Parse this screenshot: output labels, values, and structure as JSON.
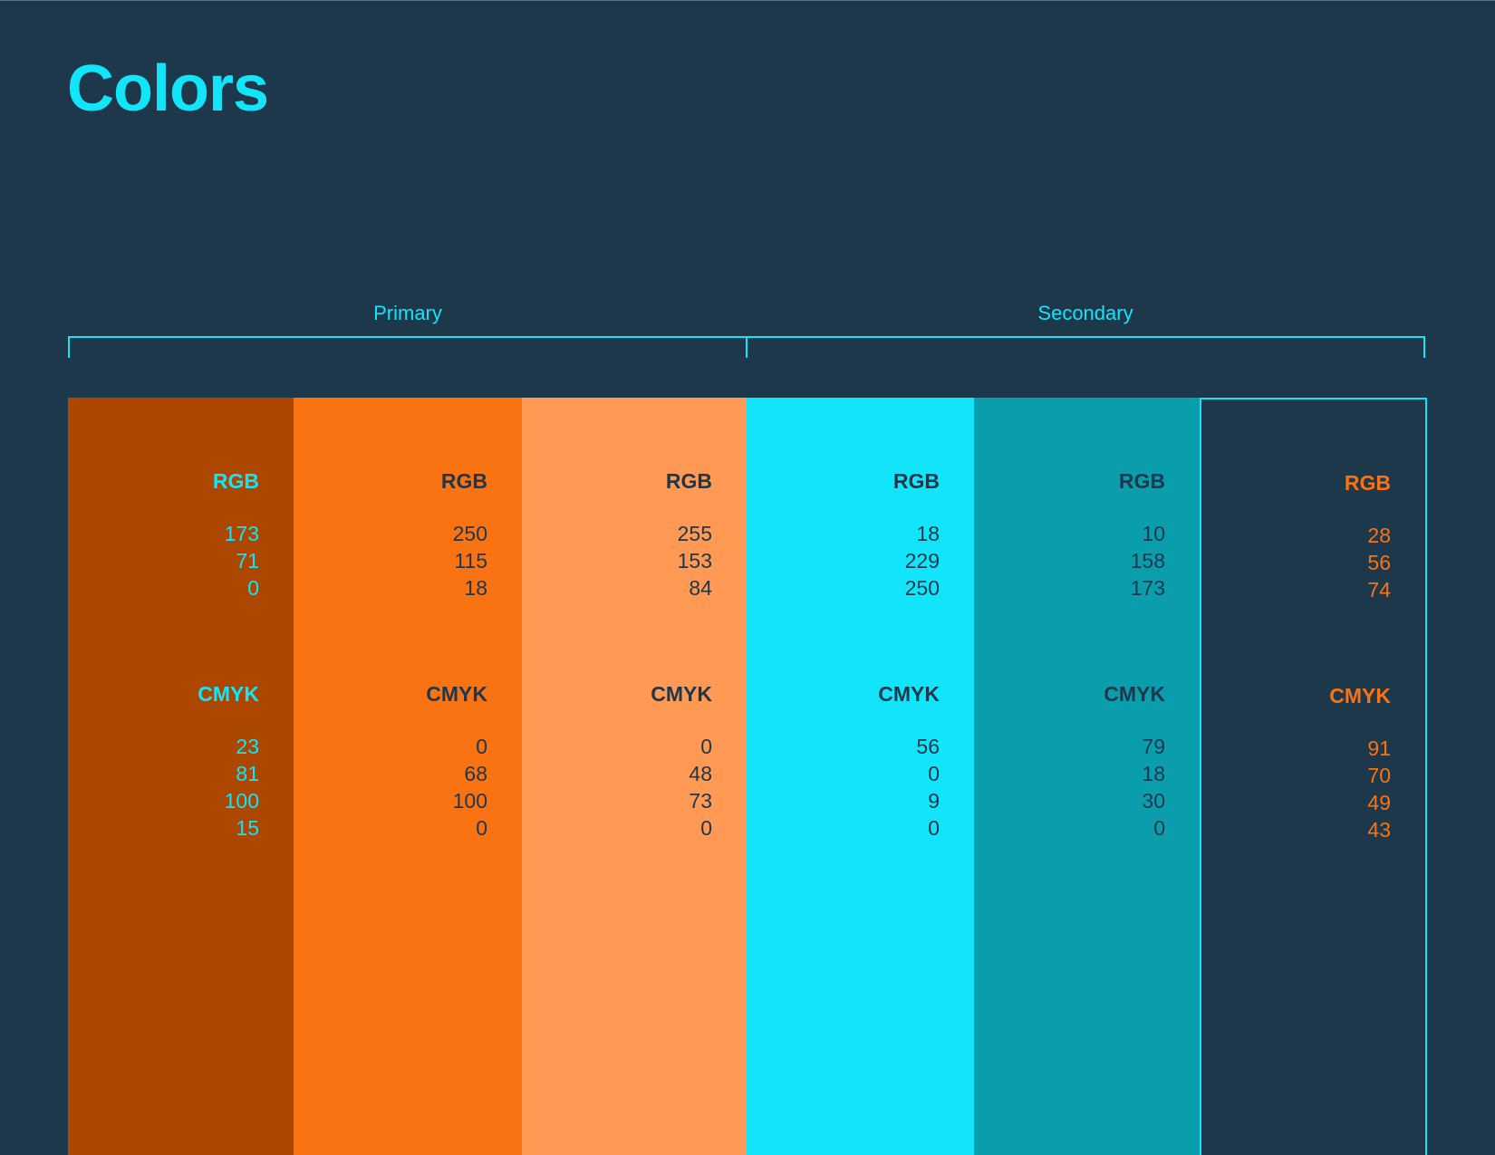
{
  "title": "Colors",
  "groups": {
    "primary": "Primary",
    "secondary": "Secondary"
  },
  "accent": "#12e4fa",
  "background": "#1d374b",
  "swatches": [
    {
      "fill": "#ad4700",
      "text_color": "#12e4fa",
      "outlined": false,
      "rgb_label": "RGB",
      "rgb": [
        "173",
        "71",
        "0"
      ],
      "cmyk_label": "CMYK",
      "cmyk": [
        "23",
        "81",
        "100",
        "15"
      ]
    },
    {
      "fill": "#fa7312",
      "text_color": "#1d374b",
      "outlined": false,
      "rgb_label": "RGB",
      "rgb": [
        "250",
        "115",
        "18"
      ],
      "cmyk_label": "CMYK",
      "cmyk": [
        "0",
        "68",
        "100",
        "0"
      ]
    },
    {
      "fill": "#ff9954",
      "text_color": "#1d374b",
      "outlined": false,
      "rgb_label": "RGB",
      "rgb": [
        "255",
        "153",
        "84"
      ],
      "cmyk_label": "CMYK",
      "cmyk": [
        "0",
        "48",
        "73",
        "0"
      ]
    },
    {
      "fill": "#12e5fa",
      "text_color": "#1d374b",
      "outlined": false,
      "rgb_label": "RGB",
      "rgb": [
        "18",
        "229",
        "250"
      ],
      "cmyk_label": "CMYK",
      "cmyk": [
        "56",
        "0",
        "9",
        "0"
      ]
    },
    {
      "fill": "#0a9ead",
      "text_color": "#1d374b",
      "outlined": false,
      "rgb_label": "RGB",
      "rgb": [
        "10",
        "158",
        "173"
      ],
      "cmyk_label": "CMYK",
      "cmyk": [
        "79",
        "18",
        "30",
        "0"
      ]
    },
    {
      "fill": "#1c384a",
      "text_color": "#fa7312",
      "outlined": true,
      "rgb_label": "RGB",
      "rgb": [
        "28",
        "56",
        "74"
      ],
      "cmyk_label": "CMYK",
      "cmyk": [
        "91",
        "70",
        "49",
        "43"
      ]
    }
  ]
}
